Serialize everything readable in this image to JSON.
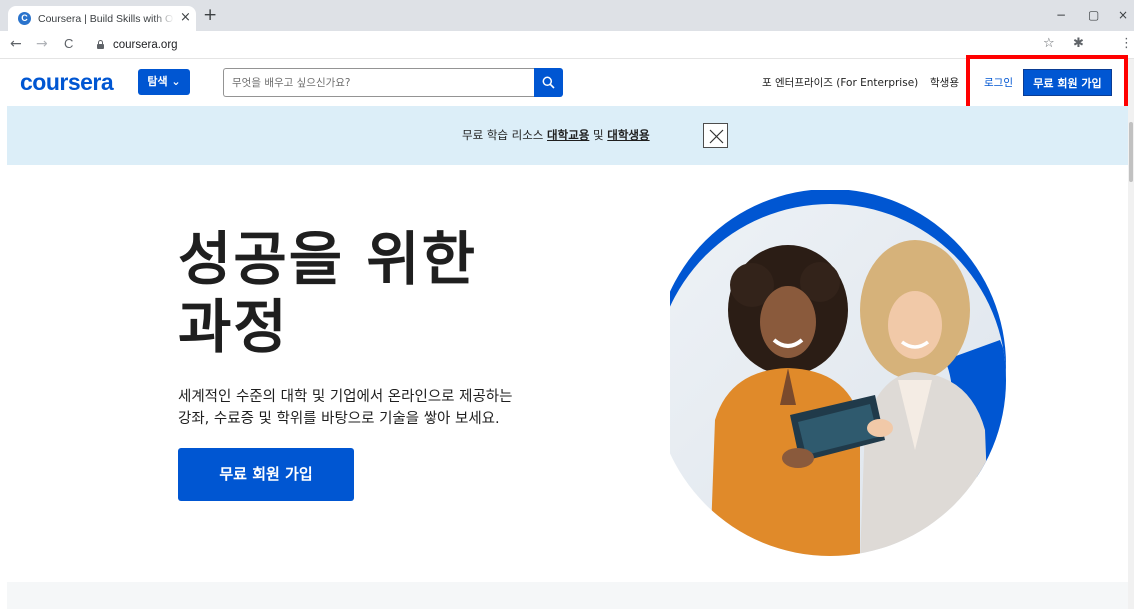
{
  "browser": {
    "tab_title": "Coursera | Build Skills with Onli",
    "favicon_letter": "C",
    "new_tab": "+",
    "tab_close": "×",
    "url": "coursera.org",
    "controls": {
      "minimize": "−",
      "restore": "▢",
      "close": "×"
    },
    "nav": {
      "back": "←",
      "forward": "→",
      "reload": "C"
    },
    "toolbar_icons": {
      "star": "☆",
      "extension": "✱",
      "menu": "⋮"
    }
  },
  "header": {
    "logo": "coursera",
    "explore_label": "탐색 ⌄",
    "search_placeholder": "무엇을 배우고 싶으신가요?",
    "enterprise": "포 엔터프라이즈 (For Enterprise)",
    "students": "학생용",
    "login": "로그인",
    "join": "무료 회원 가입"
  },
  "banner": {
    "prefix": "무료 학습 리소스 ",
    "link_university": "대학교용",
    "middle": " 및 ",
    "link_students": "대학생용"
  },
  "hero": {
    "title_line1": "성공을 위한",
    "title_line2": "과정",
    "subtitle_line1": "세계적인 수준의 대학 및 기업에서 온라인으로 제공하는",
    "subtitle_line2": "강좌, 수료증 및 학위를 바탕으로 기술을 쌓아 보세요.",
    "cta": "무료 회원 가입"
  },
  "colors": {
    "brand_blue": "#0056d2",
    "banner_bg": "#dceef8",
    "highlight": "#ff0000"
  }
}
